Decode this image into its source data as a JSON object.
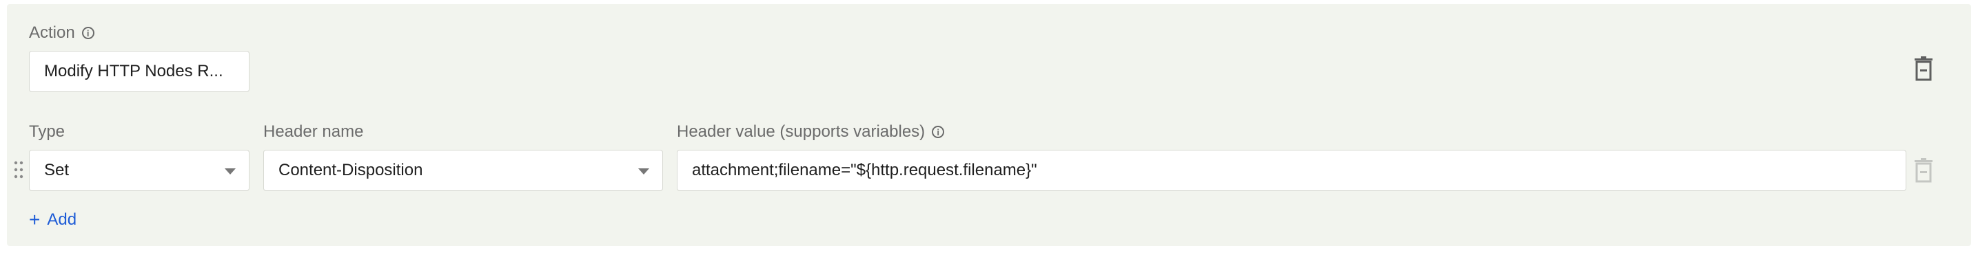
{
  "action": {
    "label": "Action",
    "label_icon": "info-icon",
    "value": "Modify HTTP Nodes R..."
  },
  "columns": {
    "type_label": "Type",
    "header_name_label": "Header name",
    "header_value_label": "Header value (supports variables)",
    "header_value_icon": "info-icon"
  },
  "rows": [
    {
      "type": "Set",
      "header_name": "Content-Disposition",
      "header_value": "attachment;filename=\"${http.request.filename}\""
    }
  ],
  "add": {
    "plus": "+",
    "label": "Add"
  },
  "colors": {
    "panel_bg": "#f2f4ee",
    "link": "#1d5bd6",
    "icon_active": "#5f5f5f",
    "icon_disabled": "#c4c6c2"
  }
}
